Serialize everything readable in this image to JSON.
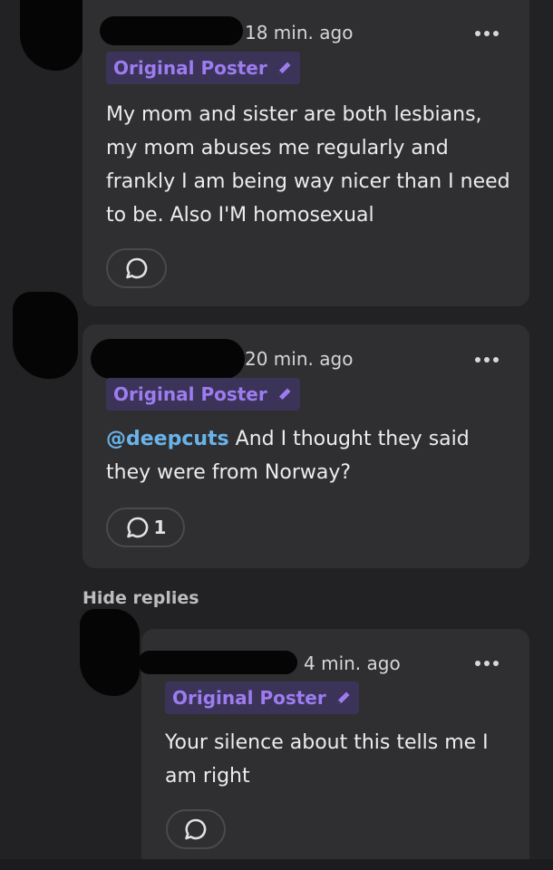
{
  "comments": [
    {
      "time": "18 min. ago",
      "badge": "Original Poster",
      "body": "My mom and sister are both lesbians, my mom abuses me regularly and frankly I am being way nicer than I need to be. Also I'M homosexual",
      "reply_count": ""
    },
    {
      "time": "20 min. ago",
      "badge": "Original Poster",
      "mention": "@deepcuts",
      "body": " And I thought they said they were from Norway?",
      "reply_count": "1"
    },
    {
      "time": "4 min. ago",
      "badge": "Original Poster",
      "body": "Your silence about this tells me I am right",
      "reply_count": ""
    }
  ],
  "hide_replies_label": "Hide replies",
  "colors": {
    "background": "#222224",
    "card": "#2f2f31",
    "badge_text": "#9d7cf0",
    "mention": "#69b3ea"
  },
  "icons": {
    "more": "more-horizontal-icon",
    "edit": "pencil-icon",
    "reply": "speech-bubble-icon"
  }
}
